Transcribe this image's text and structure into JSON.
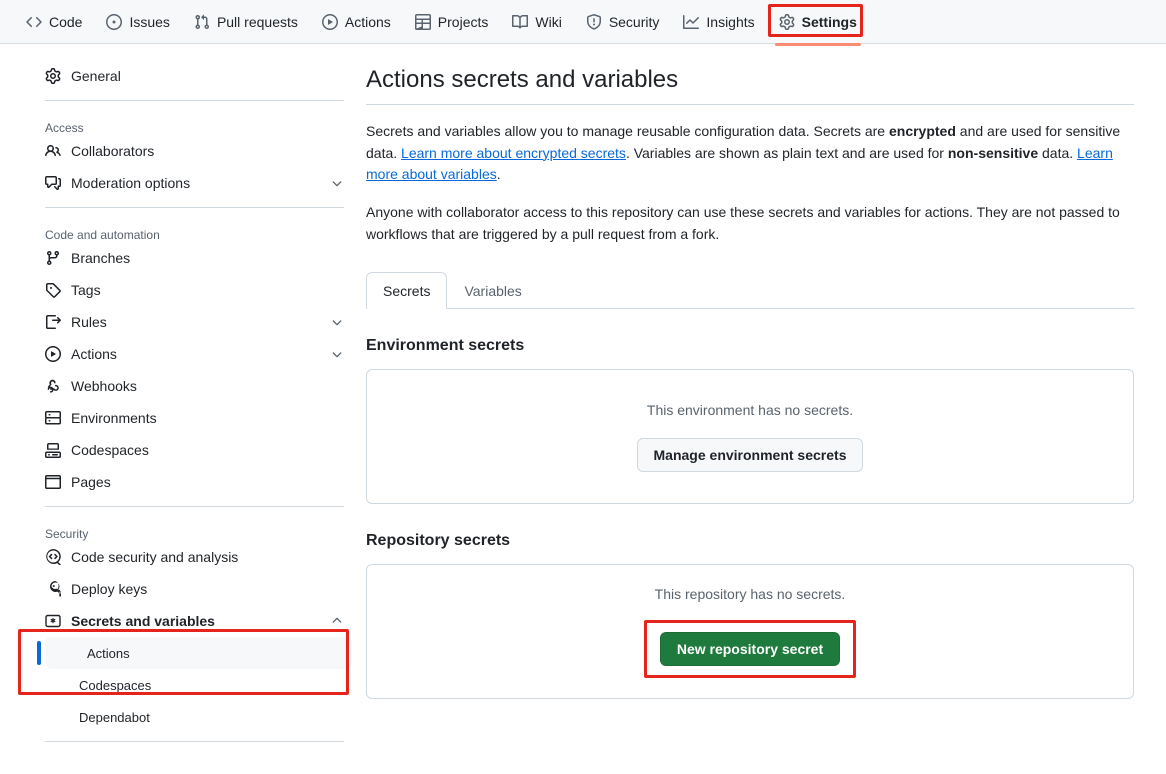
{
  "topnav": {
    "items": [
      {
        "label": "Code",
        "icon": "code-icon",
        "active": false
      },
      {
        "label": "Issues",
        "icon": "issue-opened-icon",
        "active": false
      },
      {
        "label": "Pull requests",
        "icon": "git-pull-request-icon",
        "active": false
      },
      {
        "label": "Actions",
        "icon": "play-icon",
        "active": false
      },
      {
        "label": "Projects",
        "icon": "table-icon",
        "active": false
      },
      {
        "label": "Wiki",
        "icon": "book-icon",
        "active": false
      },
      {
        "label": "Security",
        "icon": "shield-icon",
        "active": false
      },
      {
        "label": "Insights",
        "icon": "graph-icon",
        "active": false
      },
      {
        "label": "Settings",
        "icon": "gear-icon",
        "active": true
      }
    ]
  },
  "sidebar": {
    "general": {
      "label": "General",
      "icon": "gear-icon"
    },
    "groups": [
      {
        "heading": "Access",
        "items": [
          {
            "label": "Collaborators",
            "icon": "people-icon",
            "chevron": ""
          },
          {
            "label": "Moderation options",
            "icon": "comment-discussion-icon",
            "chevron": "down"
          }
        ]
      },
      {
        "heading": "Code and automation",
        "items": [
          {
            "label": "Branches",
            "icon": "git-branch-icon",
            "chevron": ""
          },
          {
            "label": "Tags",
            "icon": "tag-icon",
            "chevron": ""
          },
          {
            "label": "Rules",
            "icon": "rules-icon",
            "chevron": "down"
          },
          {
            "label": "Actions",
            "icon": "play-icon",
            "chevron": "down"
          },
          {
            "label": "Webhooks",
            "icon": "webhook-icon",
            "chevron": ""
          },
          {
            "label": "Environments",
            "icon": "server-icon",
            "chevron": ""
          },
          {
            "label": "Codespaces",
            "icon": "codespaces-icon",
            "chevron": ""
          },
          {
            "label": "Pages",
            "icon": "browser-icon",
            "chevron": ""
          }
        ]
      },
      {
        "heading": "Security",
        "items": [
          {
            "label": "Code security and analysis",
            "icon": "codescan-icon",
            "chevron": ""
          },
          {
            "label": "Deploy keys",
            "icon": "key-icon",
            "chevron": ""
          },
          {
            "label": "Secrets and variables",
            "icon": "asterisk-key-icon",
            "chevron": "up",
            "bold": true
          }
        ],
        "subitems": [
          {
            "label": "Actions",
            "selected": true
          },
          {
            "label": "Codespaces",
            "selected": false
          },
          {
            "label": "Dependabot",
            "selected": false
          }
        ]
      }
    ]
  },
  "main": {
    "title": "Actions secrets and variables",
    "paragraph1": {
      "part1": "Secrets and variables allow you to manage reusable configuration data. Secrets are ",
      "bold1": "encrypted",
      "part2": " and are used for sensitive data. ",
      "link1": "Learn more about encrypted secrets",
      "part3": ". Variables are shown as plain text and are used for ",
      "bold2": "non-sensitive",
      "part4": " data. ",
      "link2": "Learn more about variables",
      "part5": "."
    },
    "paragraph2": "Anyone with collaborator access to this repository can use these secrets and variables for actions. They are not passed to workflows that are triggered by a pull request from a fork.",
    "tabs": [
      {
        "label": "Secrets",
        "active": true
      },
      {
        "label": "Variables",
        "active": false
      }
    ],
    "environment_section": {
      "title": "Environment secrets",
      "empty_text": "This environment has no secrets.",
      "button_label": "Manage environment secrets"
    },
    "repository_section": {
      "title": "Repository secrets",
      "empty_text": "This repository has no secrets.",
      "button_label": "New repository secret"
    }
  },
  "colors": {
    "highlight_box": "#e5251b",
    "active_tab_underline": "#fd8c73",
    "primary_button": "#1f7a3d",
    "selected_indicator": "#0969da",
    "link": "#0969da"
  }
}
